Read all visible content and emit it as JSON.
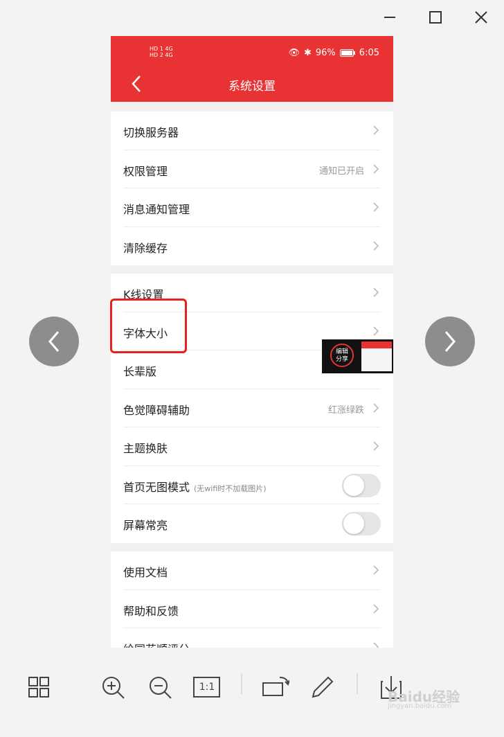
{
  "window": {
    "controls": {
      "minimize": "minimize-icon",
      "maximize": "maximize-icon",
      "close": "close-icon"
    }
  },
  "statusbar": {
    "left_top": "HD 1 4G",
    "left_bottom": "HD 2 4G",
    "battery": "96%",
    "time": "6:05"
  },
  "navbar": {
    "title": "系统设置"
  },
  "groups": [
    {
      "rows": [
        {
          "label": "切换服务器",
          "value": "",
          "type": "link"
        },
        {
          "label": "权限管理",
          "value": "通知已开启",
          "type": "link"
        },
        {
          "label": "消息通知管理",
          "value": "",
          "type": "link"
        },
        {
          "label": "清除缓存",
          "value": "",
          "type": "link"
        }
      ]
    },
    {
      "rows": [
        {
          "label": "K线设置",
          "value": "",
          "type": "link"
        },
        {
          "label": "字体大小",
          "value": "",
          "type": "link"
        },
        {
          "label": "长辈版",
          "value": "",
          "type": "link"
        },
        {
          "label": "色觉障碍辅助",
          "value": "红涨绿跌",
          "type": "link"
        },
        {
          "label": "主题换肤",
          "value": "",
          "type": "link"
        },
        {
          "label": "首页无图模式",
          "sub": "(无wifi时不加载图片)",
          "type": "toggle",
          "on": false
        },
        {
          "label": "屏幕常亮",
          "type": "toggle",
          "on": false
        }
      ]
    },
    {
      "rows": [
        {
          "label": "使用文档",
          "value": "",
          "type": "link"
        },
        {
          "label": "帮助和反馈",
          "value": "",
          "type": "link"
        },
        {
          "label": "给同花顺评分",
          "value": "",
          "type": "link"
        }
      ]
    }
  ],
  "thumbnail": {
    "edit_label_1": "编辑",
    "edit_label_2": "分享"
  },
  "viewer_toolbar": {
    "actual_size_label": "1:1"
  },
  "watermark": {
    "brand": "Baidu经验",
    "url": "jingyan.baidu.com"
  },
  "colors": {
    "accent": "#e83234",
    "highlight": "#e82020"
  }
}
